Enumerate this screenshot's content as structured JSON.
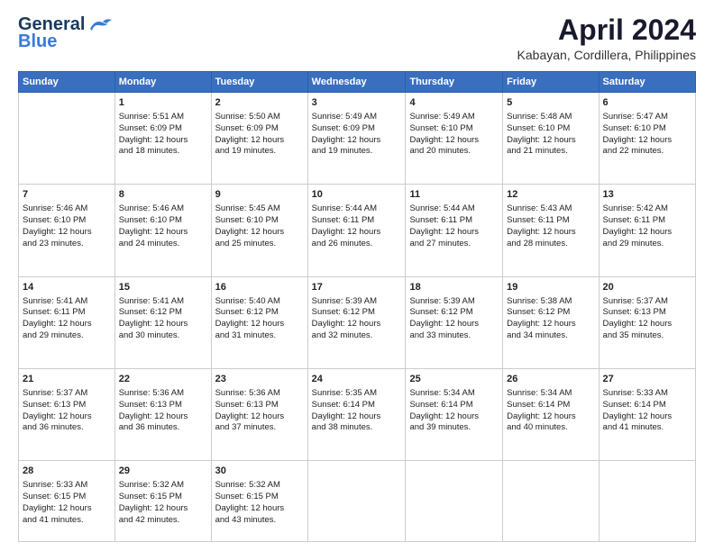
{
  "header": {
    "logo_general": "General",
    "logo_blue": "Blue",
    "month": "April 2024",
    "location": "Kabayan, Cordillera, Philippines"
  },
  "weekdays": [
    "Sunday",
    "Monday",
    "Tuesday",
    "Wednesday",
    "Thursday",
    "Friday",
    "Saturday"
  ],
  "weeks": [
    [
      {
        "day": "",
        "content": ""
      },
      {
        "day": "1",
        "content": "Sunrise: 5:51 AM\nSunset: 6:09 PM\nDaylight: 12 hours\nand 18 minutes."
      },
      {
        "day": "2",
        "content": "Sunrise: 5:50 AM\nSunset: 6:09 PM\nDaylight: 12 hours\nand 19 minutes."
      },
      {
        "day": "3",
        "content": "Sunrise: 5:49 AM\nSunset: 6:09 PM\nDaylight: 12 hours\nand 19 minutes."
      },
      {
        "day": "4",
        "content": "Sunrise: 5:49 AM\nSunset: 6:10 PM\nDaylight: 12 hours\nand 20 minutes."
      },
      {
        "day": "5",
        "content": "Sunrise: 5:48 AM\nSunset: 6:10 PM\nDaylight: 12 hours\nand 21 minutes."
      },
      {
        "day": "6",
        "content": "Sunrise: 5:47 AM\nSunset: 6:10 PM\nDaylight: 12 hours\nand 22 minutes."
      }
    ],
    [
      {
        "day": "7",
        "content": "Sunrise: 5:46 AM\nSunset: 6:10 PM\nDaylight: 12 hours\nand 23 minutes."
      },
      {
        "day": "8",
        "content": "Sunrise: 5:46 AM\nSunset: 6:10 PM\nDaylight: 12 hours\nand 24 minutes."
      },
      {
        "day": "9",
        "content": "Sunrise: 5:45 AM\nSunset: 6:10 PM\nDaylight: 12 hours\nand 25 minutes."
      },
      {
        "day": "10",
        "content": "Sunrise: 5:44 AM\nSunset: 6:11 PM\nDaylight: 12 hours\nand 26 minutes."
      },
      {
        "day": "11",
        "content": "Sunrise: 5:44 AM\nSunset: 6:11 PM\nDaylight: 12 hours\nand 27 minutes."
      },
      {
        "day": "12",
        "content": "Sunrise: 5:43 AM\nSunset: 6:11 PM\nDaylight: 12 hours\nand 28 minutes."
      },
      {
        "day": "13",
        "content": "Sunrise: 5:42 AM\nSunset: 6:11 PM\nDaylight: 12 hours\nand 29 minutes."
      }
    ],
    [
      {
        "day": "14",
        "content": "Sunrise: 5:41 AM\nSunset: 6:11 PM\nDaylight: 12 hours\nand 29 minutes."
      },
      {
        "day": "15",
        "content": "Sunrise: 5:41 AM\nSunset: 6:12 PM\nDaylight: 12 hours\nand 30 minutes."
      },
      {
        "day": "16",
        "content": "Sunrise: 5:40 AM\nSunset: 6:12 PM\nDaylight: 12 hours\nand 31 minutes."
      },
      {
        "day": "17",
        "content": "Sunrise: 5:39 AM\nSunset: 6:12 PM\nDaylight: 12 hours\nand 32 minutes."
      },
      {
        "day": "18",
        "content": "Sunrise: 5:39 AM\nSunset: 6:12 PM\nDaylight: 12 hours\nand 33 minutes."
      },
      {
        "day": "19",
        "content": "Sunrise: 5:38 AM\nSunset: 6:12 PM\nDaylight: 12 hours\nand 34 minutes."
      },
      {
        "day": "20",
        "content": "Sunrise: 5:37 AM\nSunset: 6:13 PM\nDaylight: 12 hours\nand 35 minutes."
      }
    ],
    [
      {
        "day": "21",
        "content": "Sunrise: 5:37 AM\nSunset: 6:13 PM\nDaylight: 12 hours\nand 36 minutes."
      },
      {
        "day": "22",
        "content": "Sunrise: 5:36 AM\nSunset: 6:13 PM\nDaylight: 12 hours\nand 36 minutes."
      },
      {
        "day": "23",
        "content": "Sunrise: 5:36 AM\nSunset: 6:13 PM\nDaylight: 12 hours\nand 37 minutes."
      },
      {
        "day": "24",
        "content": "Sunrise: 5:35 AM\nSunset: 6:14 PM\nDaylight: 12 hours\nand 38 minutes."
      },
      {
        "day": "25",
        "content": "Sunrise: 5:34 AM\nSunset: 6:14 PM\nDaylight: 12 hours\nand 39 minutes."
      },
      {
        "day": "26",
        "content": "Sunrise: 5:34 AM\nSunset: 6:14 PM\nDaylight: 12 hours\nand 40 minutes."
      },
      {
        "day": "27",
        "content": "Sunrise: 5:33 AM\nSunset: 6:14 PM\nDaylight: 12 hours\nand 41 minutes."
      }
    ],
    [
      {
        "day": "28",
        "content": "Sunrise: 5:33 AM\nSunset: 6:15 PM\nDaylight: 12 hours\nand 41 minutes."
      },
      {
        "day": "29",
        "content": "Sunrise: 5:32 AM\nSunset: 6:15 PM\nDaylight: 12 hours\nand 42 minutes."
      },
      {
        "day": "30",
        "content": "Sunrise: 5:32 AM\nSunset: 6:15 PM\nDaylight: 12 hours\nand 43 minutes."
      },
      {
        "day": "",
        "content": ""
      },
      {
        "day": "",
        "content": ""
      },
      {
        "day": "",
        "content": ""
      },
      {
        "day": "",
        "content": ""
      }
    ]
  ]
}
